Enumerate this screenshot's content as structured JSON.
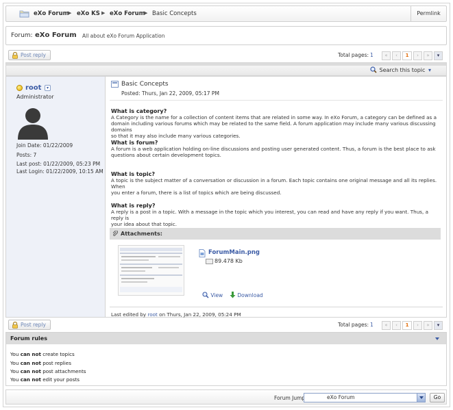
{
  "breadcrumb": {
    "items": [
      "eXo Forum",
      "eXo KS",
      "eXo Forum",
      "Basic Concepts"
    ],
    "permlink": "Permlink"
  },
  "forum_info": {
    "label": "Forum:",
    "name": "eXo Forum",
    "description": "All about eXo Forum Application"
  },
  "toolbar_top": {
    "post_reply": "Post reply",
    "total_pages_label": "Total pages:",
    "total_pages": "1",
    "current_page": "1"
  },
  "search": {
    "label": "Search this topic"
  },
  "user": {
    "name": "root",
    "role": "Administrator",
    "join_date": "Join Date: 01/22/2009",
    "posts": "Posts: 7",
    "last_post": "Last post: 01/22/2009, 05:23 PM",
    "last_login": "Last Login: 01/22/2009, 10:15 AM"
  },
  "post": {
    "title": "Basic Concepts",
    "posted": "Posted: Thurs, Jan 22, 2009, 05:17 PM",
    "sections": [
      {
        "heading": "What is category?",
        "lines": [
          "A Category is the name for a collection of content items that are related in some way. In eXo Forum,  a category can be defined as a",
          "domain including various forums which may be related to the same field. A forum application may include many various discussing domains",
          "so that it may  also include many various categories."
        ]
      },
      {
        "heading": "What is forum?",
        "lines": [
          "A forum is a web application holding on-line discussions and posting user generated content. Thus, a forum is the best place to ask",
          "questions about certain development topics."
        ]
      },
      {
        "heading": "What is topic?",
        "lines": [
          "A topic is the subject matter of a conversation or discussion in a forum. Each topic contains one original message and all its replies. When",
          "you enter a forum, there is a list of topics which are being discussed."
        ]
      },
      {
        "heading": "What is reply?",
        "lines": [
          "A reply is a post in a topic. With a message in the topic which you interest, you can read and have any reply if you want. Thus, a reply is",
          "your idea about that topic."
        ]
      }
    ],
    "attachments_label": "Attachments:",
    "attachment": {
      "file_name": "ForumMain.png",
      "file_size": "89.478 Kb",
      "view": "View",
      "download": "Download"
    },
    "edited_prefix": "Last edited by",
    "edited_user": "root",
    "edited_suffix": "on Thurs, Jan 22, 2009, 05:24 PM"
  },
  "toolbar_bottom": {
    "post_reply": "Post reply",
    "total_pages_label": "Total pages:",
    "total_pages": "1",
    "current_page": "1"
  },
  "rules": {
    "title": "Forum rules",
    "items": [
      {
        "prefix": "You",
        "bold": "can not",
        "suffix": "create topics"
      },
      {
        "prefix": "You",
        "bold": "can not",
        "suffix": "post replies"
      },
      {
        "prefix": "You",
        "bold": "can not",
        "suffix": "post attachments"
      },
      {
        "prefix": "You",
        "bold": "can not",
        "suffix": "edit your posts"
      }
    ]
  },
  "jump": {
    "label": "Forum Jump:",
    "selected": "eXo Forum",
    "go": "Go"
  },
  "colors": {
    "link": "#3b5ba5",
    "current_page": "#e36c09",
    "user_panel": "#eef1f8",
    "header_bar": "#dcdcdc"
  }
}
